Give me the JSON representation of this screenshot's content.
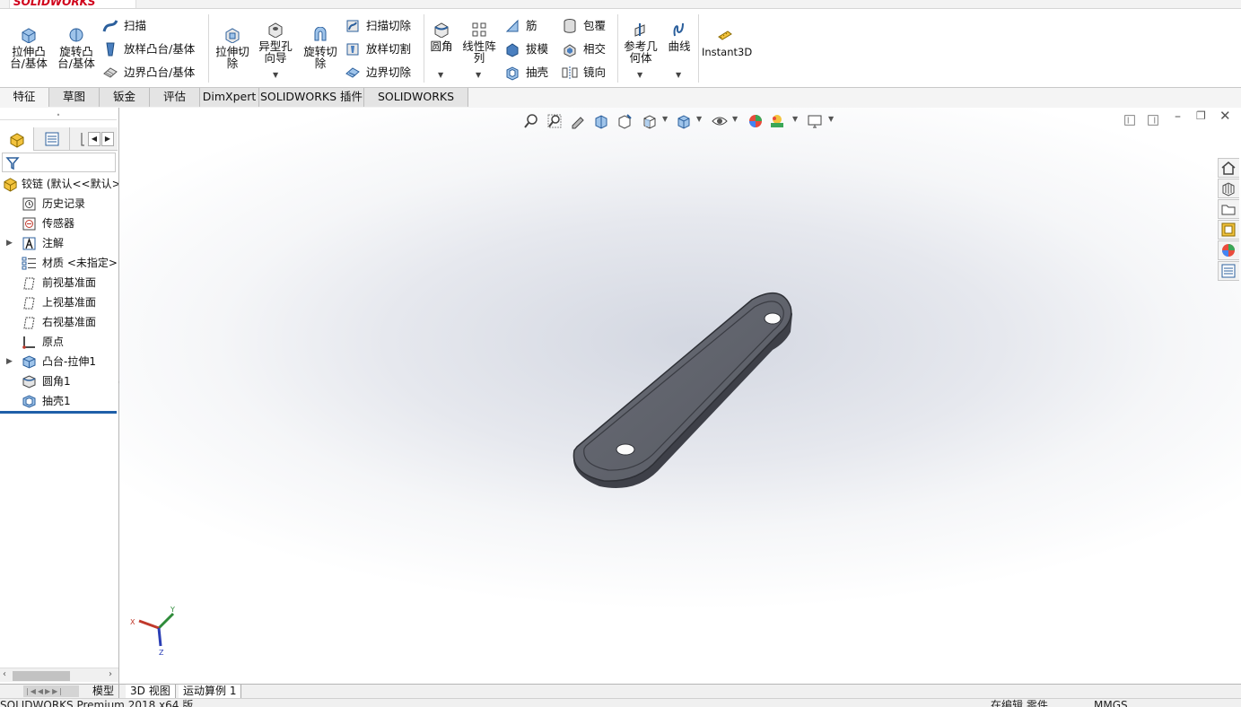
{
  "app": {
    "logo": "SOLIDWORKS",
    "edition_status": "SOLIDWORKS Premium 2018 x64 版",
    "edit_state": "在编辑 零件",
    "units": "MMGS"
  },
  "ribbon": {
    "extrude_boss": "拉伸凸\n台/基体",
    "revolve_boss": "旋转凸\n台/基体",
    "sweep": "扫描",
    "loft_boss": "放样凸台/基体",
    "boundary_boss": "边界凸台/基体",
    "extrude_cut": "拉伸切\n除",
    "hole_wizard": "异型孔\n向导",
    "revolve_cut": "旋转切\n除",
    "swept_cut": "扫描切除",
    "lofted_cut": "放样切割",
    "boundary_cut": "边界切除",
    "fillet": "圆角",
    "linear_pattern": "线性阵\n列",
    "rib": "筋",
    "draft": "拔模",
    "shell": "抽壳",
    "wrap": "包覆",
    "intersect": "相交",
    "mirror": "镜向",
    "ref_geometry": "参考几\n何体",
    "curves": "曲线",
    "instant3d": "Instant3D"
  },
  "tabs": [
    "特征",
    "草图",
    "钣金",
    "评估",
    "DimXpert",
    "SOLIDWORKS 插件",
    "SOLIDWORKS MBD"
  ],
  "feature_tree": {
    "root": "铰链 (默认<<默认>",
    "items": [
      {
        "label": "历史记录",
        "icon": "history-icon",
        "expand": false
      },
      {
        "label": "传感器",
        "icon": "sensor-icon",
        "expand": false
      },
      {
        "label": "注解",
        "icon": "annotations-icon",
        "expand": true
      },
      {
        "label": "材质 <未指定>",
        "icon": "material-icon",
        "expand": false
      },
      {
        "label": "前视基准面",
        "icon": "plane-icon",
        "expand": false
      },
      {
        "label": "上视基准面",
        "icon": "plane-icon",
        "expand": false
      },
      {
        "label": "右视基准面",
        "icon": "plane-icon",
        "expand": false
      },
      {
        "label": "原点",
        "icon": "origin-icon",
        "expand": false
      },
      {
        "label": "凸台-拉伸1",
        "icon": "extrude-feature-icon",
        "expand": true
      },
      {
        "label": "圆角1",
        "icon": "fillet-feature-icon",
        "expand": false
      },
      {
        "label": "抽壳1",
        "icon": "shell-feature-icon",
        "expand": false
      }
    ]
  },
  "bottom_tabs": [
    "模型",
    "3D 视图",
    "运动算例 1"
  ],
  "triad": {
    "x": "X",
    "y": "Y",
    "z": "Z"
  },
  "colors": {
    "part": "#5e616b",
    "accent": "#1f5fa8",
    "brand": "#d0021b"
  }
}
